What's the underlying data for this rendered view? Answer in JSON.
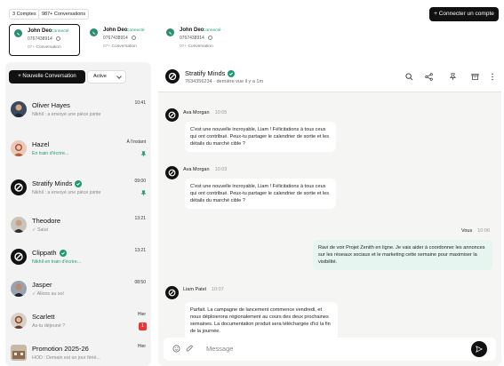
{
  "header": {
    "accounts_count": "3 Comptes",
    "conversations_count": "987+ Conversations",
    "connect_button": "+ Connecter un compte"
  },
  "accounts": [
    {
      "name": "John Deo",
      "status": "Connecté",
      "phone": "0767438914",
      "conv_count": "07+",
      "conv_label": "Conversation"
    },
    {
      "name": "John Deo",
      "status": "Connecté",
      "phone": "0767438914",
      "conv_count": "07+",
      "conv_label": "Conversation"
    },
    {
      "name": "John Deo",
      "status": "Connecté",
      "phone": "0767438914",
      "conv_count": "07+",
      "conv_label": "Conversation"
    }
  ],
  "sidebar": {
    "new_conversation": "+ Nouvelle Conversation",
    "filter_value": "Active",
    "conversations": [
      {
        "name": "Oliver Hayes",
        "time": "10:41",
        "preview": "Nikhil : a envoyé une pièce jointe"
      },
      {
        "name": "Hazel",
        "time": "À l'instant",
        "preview": "En train d'écrire..."
      },
      {
        "name": "Stratify Minds",
        "time": "09:00",
        "preview": "Nikhil : a envoyé une pièce jointe"
      },
      {
        "name": "Theodore",
        "time": "13:21",
        "preview": "Salut"
      },
      {
        "name": "Clippath",
        "time": "13:21",
        "preview": "Nikhil en train d'écrire..."
      },
      {
        "name": "Jasper",
        "time": "08:50",
        "preview": "Allons au sol"
      },
      {
        "name": "Scarlett",
        "time": "Hier",
        "preview": "As-tu déjeuné ?",
        "badge": "1"
      },
      {
        "name": "Promotion 2025-26",
        "time": "Hier",
        "preview": "HOD : Demain est un jour férié..."
      }
    ]
  },
  "chat": {
    "name": "Stratify Minds",
    "subtitle": "7634356234 · dernière vue il y a 1m",
    "messages": [
      {
        "sender": "Ava Morgan",
        "time": "10:05",
        "text": "C'est une nouvelle incroyable, Liam ! Félicitations à tous ceux qui ont contribué. Peux-tu partager le calendrier de sortie et les détails du marché cible ?"
      },
      {
        "sender": "Ava Morgan",
        "time": "10:03",
        "text": "C'est une nouvelle incroyable, Liam ! Félicitations à tous ceux qui ont contribué. Peux-tu partager le calendrier de sortie et les détails du marché cible ?"
      },
      {
        "sender": "Vous",
        "time": "10:06",
        "text": "Ravi de voir Projet Zenith en ligne. Je vais aider à coordonner les annonces sur les réseaux sociaux et le marketing cette semaine pour maximiser la visibilité."
      },
      {
        "sender": "Liam Patel",
        "time": "10:07",
        "text": "Parfait. La campagne de lancement commence vendredi, et nous déploierons régionalement au cours des deux prochaines semaines. La documentation produit sera téléchargée d'ici la fin de la journée."
      }
    ],
    "composer_placeholder": "Message"
  },
  "colors": {
    "accent_green": "#1e9b6d",
    "dark": "#111111",
    "badge_red": "#e53935"
  }
}
